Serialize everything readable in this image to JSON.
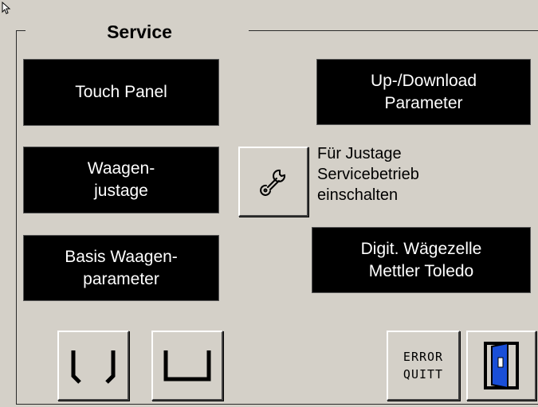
{
  "group": {
    "title": "Service"
  },
  "buttons": {
    "touch_panel": "Touch Panel",
    "updownload": "Up-/Download\nParameter",
    "waagenjustage": "Waagen-\njustage",
    "basis": "Basis Waagen-\nparameter",
    "digit": "Digit. Wägezelle\nMettler Toledo",
    "error_quitt": "ERROR\nQUITT"
  },
  "service_note": "Für Justage\nServicebetrieb\neinschalten",
  "icons": {
    "service_toggle": "wrench-icon",
    "left_nav": "bracket-icon",
    "right_nav": "tray-icon",
    "exit": "door-exit-icon"
  },
  "colors": {
    "background": "#d4d0c8",
    "button_black": "#000000",
    "button_text": "#ffffff",
    "door_blue": "#1a4fd8"
  }
}
